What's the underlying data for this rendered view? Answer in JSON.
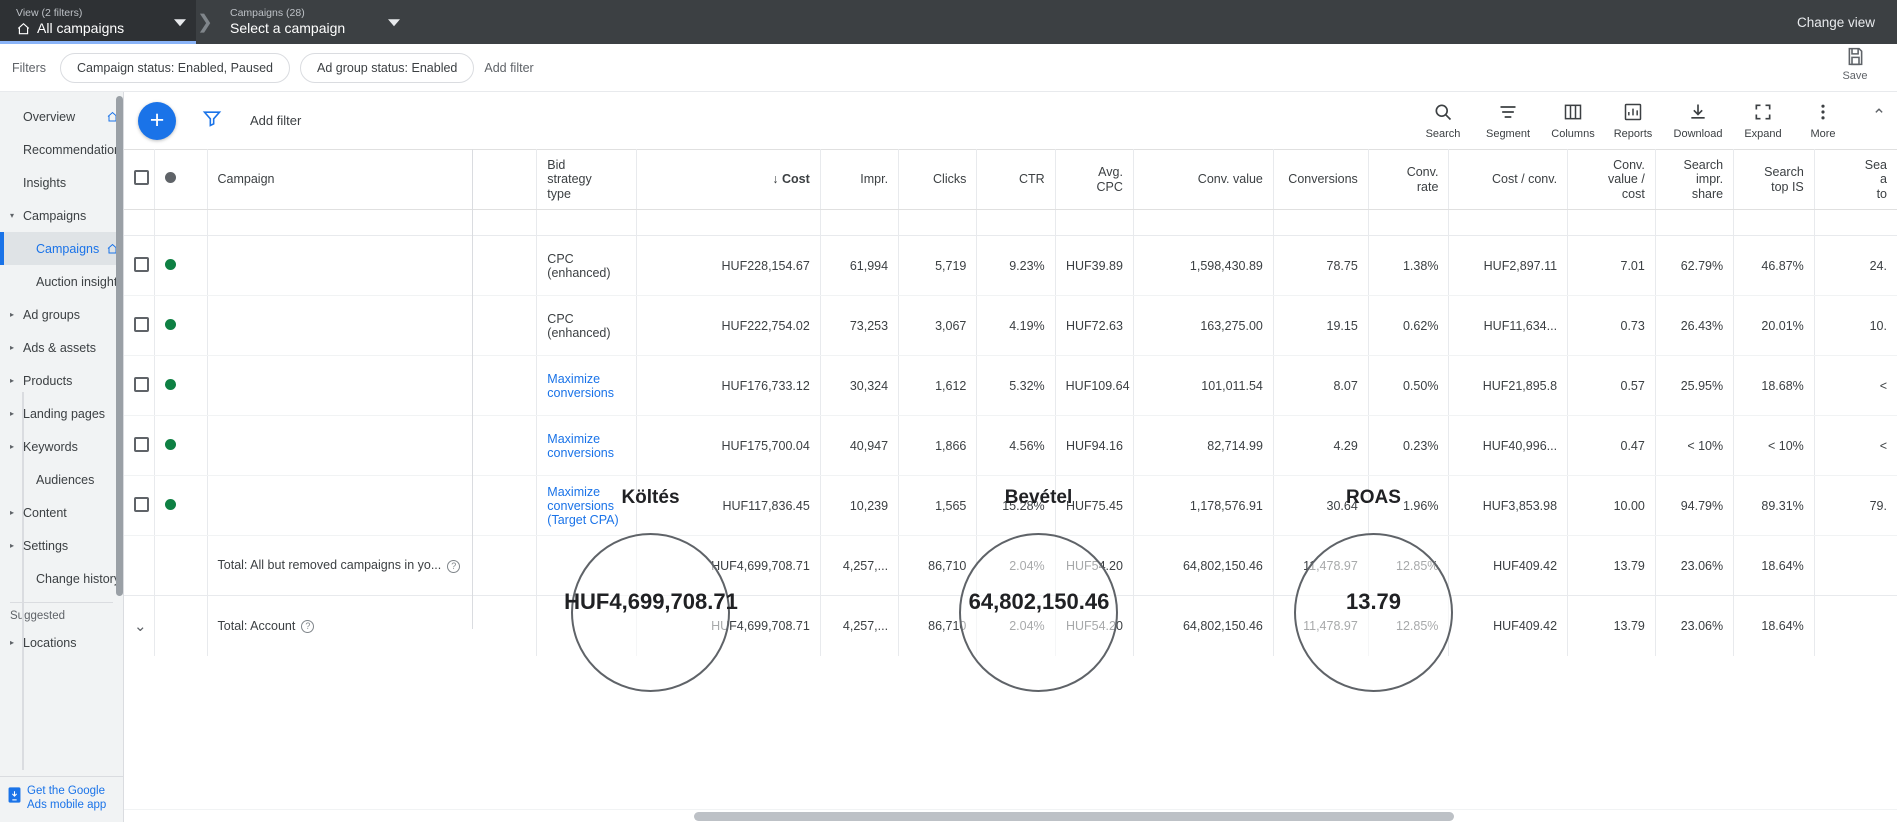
{
  "topbar": {
    "view_sub": "View (2 filters)",
    "view_main": "All campaigns",
    "campaign_sub": "Campaigns (28)",
    "campaign_main": "Select a campaign",
    "change_view": "Change view"
  },
  "filterbar": {
    "label": "Filters",
    "chips": [
      "Campaign status: Enabled, Paused",
      "Ad group status: Enabled"
    ],
    "add_filter": "Add filter",
    "save_label": "Save"
  },
  "sidebar": {
    "items": [
      {
        "label": "Overview",
        "arrow": "",
        "home": true,
        "indent": false,
        "selected": false
      },
      {
        "label": "Recommendations",
        "arrow": "",
        "home": false,
        "indent": false,
        "selected": false
      },
      {
        "label": "Insights",
        "arrow": "",
        "home": false,
        "indent": false,
        "selected": false
      },
      {
        "label": "Campaigns",
        "arrow": "▾",
        "home": false,
        "indent": false,
        "selected": false
      },
      {
        "label": "Campaigns",
        "arrow": "",
        "home": true,
        "indent": true,
        "selected": true
      },
      {
        "label": "Auction insights",
        "arrow": "",
        "home": false,
        "indent": true,
        "selected": false
      },
      {
        "label": "Ad groups",
        "arrow": "▸",
        "home": false,
        "indent": false,
        "selected": false
      },
      {
        "label": "Ads & assets",
        "arrow": "▸",
        "home": false,
        "indent": false,
        "selected": false
      },
      {
        "label": "Products",
        "arrow": "▸",
        "home": false,
        "indent": false,
        "selected": false
      },
      {
        "label": "Landing pages",
        "arrow": "▸",
        "home": false,
        "indent": false,
        "selected": false
      },
      {
        "label": "Keywords",
        "arrow": "▸",
        "home": false,
        "indent": false,
        "selected": false
      },
      {
        "label": "Audiences",
        "arrow": "",
        "home": false,
        "indent": true,
        "selected": false
      },
      {
        "label": "Content",
        "arrow": "▸",
        "home": false,
        "indent": false,
        "selected": false
      },
      {
        "label": "Settings",
        "arrow": "▸",
        "home": false,
        "indent": false,
        "selected": false
      },
      {
        "label": "Change history",
        "arrow": "",
        "home": false,
        "indent": true,
        "selected": false
      }
    ],
    "suggested_heading": "Suggested",
    "suggested_items": [
      {
        "label": "Locations",
        "arrow": "▸"
      }
    ],
    "footer_line1": "Get the Google",
    "footer_line2": "Ads mobile app"
  },
  "toolbar": {
    "add_label": "+",
    "add_filter": "Add filter",
    "actions": [
      {
        "label": "Search",
        "icon": "search-icon"
      },
      {
        "label": "Segment",
        "icon": "segment-icon"
      },
      {
        "label": "Columns",
        "icon": "columns-icon"
      },
      {
        "label": "Reports",
        "icon": "reports-icon"
      },
      {
        "label": "Download",
        "icon": "download-icon"
      },
      {
        "label": "Expand",
        "icon": "expand-icon"
      },
      {
        "label": "More",
        "icon": "more-icon"
      }
    ]
  },
  "table": {
    "columns": [
      "Campaign",
      "Bid strategy type",
      "Cost",
      "Impr.",
      "Clicks",
      "CTR",
      "Avg. CPC",
      "Conv. value",
      "Conversions",
      "Conv. rate",
      "Cost / conv.",
      "Conv. value / cost",
      "Search impr. share",
      "Search top IS",
      "Search abs. top IS"
    ],
    "sorted_column": "Cost",
    "sort_arrow": "↓",
    "rows": [
      {
        "status": "enabled",
        "bid_strategy": "CPC (enhanced)",
        "cost": "HUF228,154.67",
        "impr": "61,994",
        "clicks": "5,719",
        "ctr": "9.23%",
        "avg_cpc": "HUF39.89",
        "conv_value": "1,598,430.89",
        "conversions": "78.75",
        "conv_rate": "1.38%",
        "cost_per_conv": "HUF2,897.11",
        "conv_value_cost": "7.01",
        "search_impr_share": "62.79%",
        "search_top_is": "46.87%",
        "search_abs_top_is": "24."
      },
      {
        "status": "enabled",
        "bid_strategy": "CPC (enhanced)",
        "cost": "HUF222,754.02",
        "impr": "73,253",
        "clicks": "3,067",
        "ctr": "4.19%",
        "avg_cpc": "HUF72.63",
        "conv_value": "163,275.00",
        "conversions": "19.15",
        "conv_rate": "0.62%",
        "cost_per_conv": "HUF11,634...",
        "conv_value_cost": "0.73",
        "search_impr_share": "26.43%",
        "search_top_is": "20.01%",
        "search_abs_top_is": "10."
      },
      {
        "status": "enabled",
        "bid_strategy": "Maximize conversions",
        "cost": "HUF176,733.12",
        "impr": "30,324",
        "clicks": "1,612",
        "ctr": "5.32%",
        "avg_cpc": "HUF109.64",
        "conv_value": "101,011.54",
        "conversions": "8.07",
        "conv_rate": "0.50%",
        "cost_per_conv": "HUF21,895.8",
        "conv_value_cost": "0.57",
        "search_impr_share": "25.95%",
        "search_top_is": "18.68%",
        "search_abs_top_is": "<"
      },
      {
        "status": "enabled",
        "bid_strategy": "Maximize conversions",
        "cost": "HUF175,700.04",
        "impr": "40,947",
        "clicks": "1,866",
        "ctr": "4.56%",
        "avg_cpc": "HUF94.16",
        "conv_value": "82,714.99",
        "conversions": "4.29",
        "conv_rate": "0.23%",
        "cost_per_conv": "HUF40,996...",
        "conv_value_cost": "0.47",
        "search_impr_share": "< 10%",
        "search_top_is": "< 10%",
        "search_abs_top_is": "<"
      },
      {
        "status": "enabled",
        "bid_strategy": "Maximize conversions (Target CPA)",
        "cost": "HUF117,836.45",
        "impr": "10,239",
        "clicks": "1,565",
        "ctr": "15.28%",
        "avg_cpc": "HUF75.45",
        "conv_value": "1,178,576.91",
        "conversions": "30.64",
        "conv_rate": "1.96%",
        "cost_per_conv": "HUF3,853.98",
        "conv_value_cost": "10.00",
        "search_impr_share": "94.79%",
        "search_top_is": "89.31%",
        "search_abs_top_is": "79."
      }
    ],
    "total_all": {
      "label": "Total: All but removed campaigns in yo...",
      "cost": "HUF4,699,708.71",
      "impr": "4,257,...",
      "clicks": "86,710",
      "ctr": "2.04%",
      "avg_cpc": "HUF54.20",
      "conv_value": "64,802,150.46",
      "conversions": "11,478.97",
      "conv_rate": "12.85%",
      "cost_per_conv": "HUF409.42",
      "conv_value_cost": "13.79",
      "search_impr_share": "23.06%",
      "search_top_is": "18.64%",
      "search_abs_top_is": ""
    },
    "total_account": {
      "label": "Total: Account",
      "cost": "HUF4,699,708.71",
      "impr": "4,257,...",
      "clicks": "86,710",
      "ctr": "2.04%",
      "avg_cpc": "HUF54.20",
      "conv_value": "64,802,150.46",
      "conversions": "11,478.97",
      "conv_rate": "12.85%",
      "cost_per_conv": "HUF409.42",
      "conv_value_cost": "13.79",
      "search_impr_share": "23.06%",
      "search_top_is": "18.64%",
      "search_abs_top_is": ""
    }
  },
  "annotations": [
    {
      "label": "Költés",
      "value": "HUF4,699,708.71"
    },
    {
      "label": "Bevétel",
      "value": "64,802,150.46"
    },
    {
      "label": "ROAS",
      "value": "13.79"
    }
  ],
  "colors": {
    "accent_blue": "#1a73e8",
    "topbar_dark": "#3c4043",
    "status_green": "#0e8043",
    "tab_underline": "#8ab4f8"
  }
}
